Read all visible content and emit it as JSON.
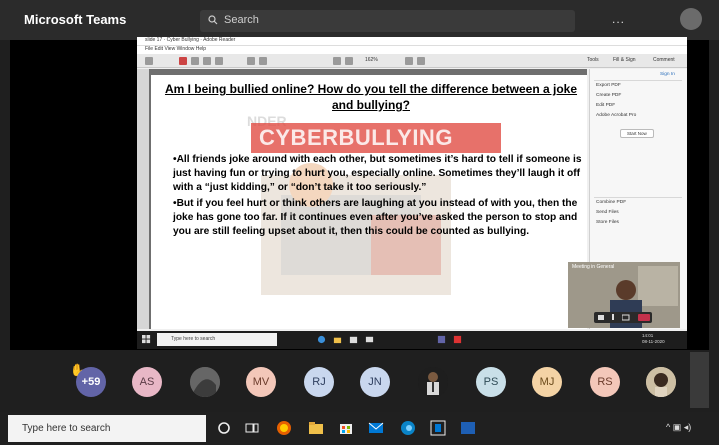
{
  "teams": {
    "title": "Microsoft Teams",
    "search_placeholder": "Search",
    "more_label": "..."
  },
  "pdf_viewer": {
    "window_title": "slide 17 · Cyber Bullying · Adobe Reader",
    "menu": "File  Edit  View  Window  Help",
    "tools_tabs": [
      "Tools",
      "Fill & Sign",
      "Comment"
    ],
    "sign_in": "Sign In",
    "right_pane": {
      "items": [
        "Export PDF",
        "Create PDF",
        "Edit PDF"
      ],
      "promo": "Adobe Acrobat Pro",
      "start_now": "Start Now",
      "items_lower": [
        "Combine PDF",
        "Send Files",
        "Store Files"
      ]
    },
    "zoom": "162%"
  },
  "slide": {
    "watermark_top": "NDER",
    "banner": "CYBERBULLYING",
    "title": "Am I being bullied online? How do you tell the difference between a joke and bullying?",
    "bullet1": "•All friends joke around with each other, but sometimes it’s hard to tell if someone is just having fun or trying to hurt you, especially online. Sometimes they’ll laugh it off with a “just kidding,” or “don’t take it too seriously.”",
    "bullet2": "•But if you feel hurt or think others are laughing at you instead of with you, then the joke has gone too far. If it continues even after you’ve asked the person to stop and you are still feeling upset about it, then this could be counted as bullying."
  },
  "inner_taskbar": {
    "search": "Type here to search",
    "time": "14:01",
    "date": "08-11-2020"
  },
  "self_video": {
    "label": "Meeting in General"
  },
  "participants": [
    {
      "label": "+59",
      "type": "more"
    },
    {
      "label": "AS",
      "type": "initials",
      "color": "#e8b7c6"
    },
    {
      "label": "",
      "type": "photo"
    },
    {
      "label": "MV",
      "type": "initials",
      "color": "#f3c7b9"
    },
    {
      "label": "RJ",
      "type": "initials",
      "color": "#c9d7ee"
    },
    {
      "label": "JN",
      "type": "initials",
      "color": "#c9d7ee"
    },
    {
      "label": "",
      "type": "photo"
    },
    {
      "label": "PS",
      "type": "initials",
      "color": "#c9dfe8"
    },
    {
      "label": "MJ",
      "type": "initials",
      "color": "#f4d3a5"
    },
    {
      "label": "RS",
      "type": "initials",
      "color": "#f3c7b9"
    },
    {
      "label": "",
      "type": "photo"
    }
  ],
  "win_taskbar": {
    "search_placeholder": "Type here to search"
  }
}
